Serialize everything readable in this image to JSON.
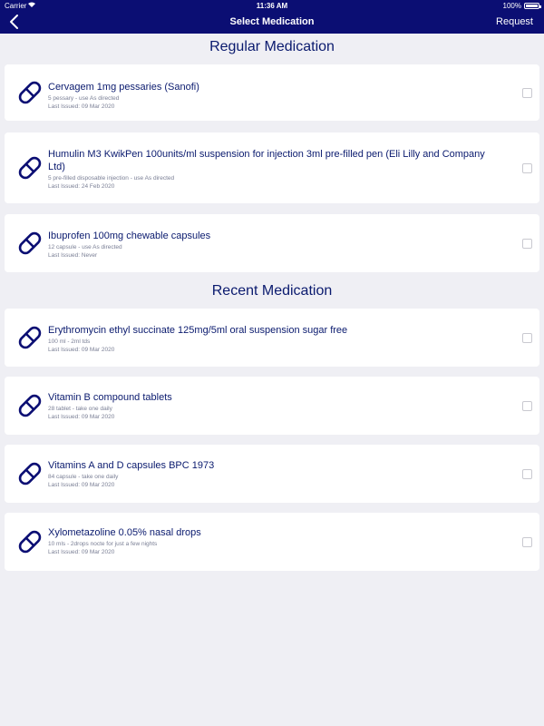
{
  "status_bar": {
    "carrier": "Carrier",
    "time": "11:36 AM",
    "battery": "100%"
  },
  "nav": {
    "title": "Select Medication",
    "request_label": "Request"
  },
  "sections": {
    "regular": "Regular Medication",
    "recent": "Recent Medication"
  },
  "regular": [
    {
      "name": "Cervagem 1mg pessaries (Sanofi)",
      "dose": "5 pessary - use As directed",
      "issued": "Last Issued: 09 Mar 2020"
    },
    {
      "name": "Humulin M3 KwikPen 100units/ml suspension for injection 3ml pre-filled pen (Eli Lilly and Company Ltd)",
      "dose": "5 pre-filled disposable injection - use As directed",
      "issued": "Last Issued: 24 Feb 2020"
    },
    {
      "name": "Ibuprofen 100mg chewable capsules",
      "dose": "12 capsule - use As directed",
      "issued": "Last Issued: Never"
    }
  ],
  "recent": [
    {
      "name": "Erythromycin ethyl succinate 125mg/5ml oral suspension sugar free",
      "dose": "100 ml - 2ml tds",
      "issued": "Last Issued: 09 Mar 2020"
    },
    {
      "name": "Vitamin B compound tablets",
      "dose": "28 tablet - take one daily",
      "issued": "Last Issued: 09 Mar 2020"
    },
    {
      "name": "Vitamins A and D capsules BPC 1973",
      "dose": "84 capsule - take one daily",
      "issued": "Last Issued: 09 Mar 2020"
    },
    {
      "name": "Xylometazoline 0.05% nasal drops",
      "dose": "10 mls - 2drops nocte for just a few nights",
      "issued": "Last Issued: 09 Mar 2020"
    }
  ],
  "colors": {
    "navbar": "#0b0e73",
    "accent": "#0a1a6e",
    "background": "#efeff4"
  },
  "icons": {
    "back": "chevron-left-icon",
    "medication": "pill-capsule-icon",
    "select": "checkbox-icon"
  }
}
